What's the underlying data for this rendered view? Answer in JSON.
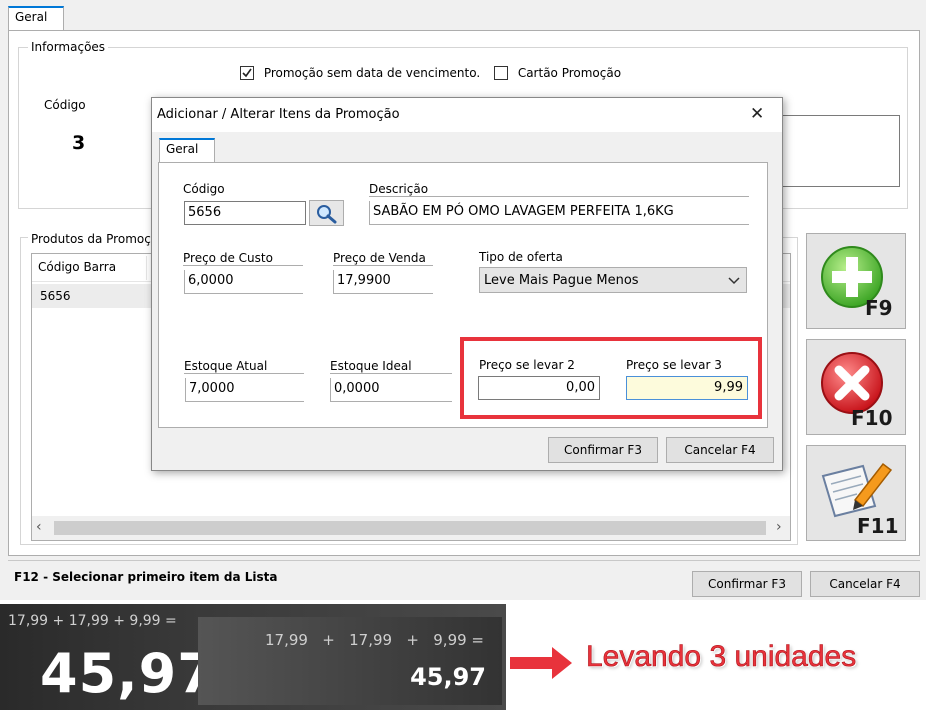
{
  "main": {
    "tab_geral": "Geral",
    "info_group_label": "Informações",
    "checkbox_sem_vencimento": {
      "label": "Promoção sem data de vencimento.",
      "checked": true
    },
    "checkbox_cartao": {
      "label": "Cartão Promoção",
      "checked": false
    },
    "codigo_label": "Código",
    "codigo_value": "3",
    "produtos_group_label": "Produtos da Promoç",
    "table_header_codigo_barra": "Código Barra",
    "table_rows": [
      {
        "codigo_barra": "5656"
      }
    ],
    "side_buttons": {
      "add": "F9",
      "remove": "F10",
      "edit": "F11"
    },
    "status_text": "F12 - Selecionar primeiro item da Lista",
    "confirm_label": "Confirmar F3",
    "cancel_label": "Cancelar F4"
  },
  "dialog": {
    "title": "Adicionar / Alterar Itens da Promoção",
    "close_glyph": "✕",
    "tab_geral": "Geral",
    "codigo_label": "Código",
    "codigo_value": "5656",
    "descricao_label": "Descrição",
    "descricao_value": "SABÃO EM PÓ OMO LAVAGEM PERFEITA 1,6KG",
    "preco_custo_label": "Preço de Custo",
    "preco_custo_value": "6,0000",
    "preco_venda_label": "Preço de Venda",
    "preco_venda_value": "17,9900",
    "tipo_oferta_label": "Tipo de oferta",
    "tipo_oferta_value": "Leve Mais Pague Menos",
    "estoque_atual_label": "Estoque Atual",
    "estoque_atual_value": "7,0000",
    "estoque_ideal_label": "Estoque Ideal",
    "estoque_ideal_value": "0,0000",
    "preco_levar2_label": "Preço se levar 2",
    "preco_levar2_value": "0,00",
    "preco_levar3_label": "Preço se levar 3",
    "preco_levar3_value": "9,99",
    "confirm_label": "Confirmar F3",
    "cancel_label": "Cancelar F4"
  },
  "calculator": {
    "expression_small": "17,99 + 17,99 + 9,99 =",
    "result_big": "45,97",
    "expression_right": "17,99   +   17,99   +   9,99 =",
    "result_right": "45,97"
  },
  "annotation": {
    "text": "Levando 3 unidades"
  },
  "colors": {
    "highlight_red": "#e8333c",
    "tab_accent": "#0078d7",
    "active_field_bg": "#fdfbdc",
    "add_green": "#5cc23a",
    "remove_red": "#e0252c"
  }
}
